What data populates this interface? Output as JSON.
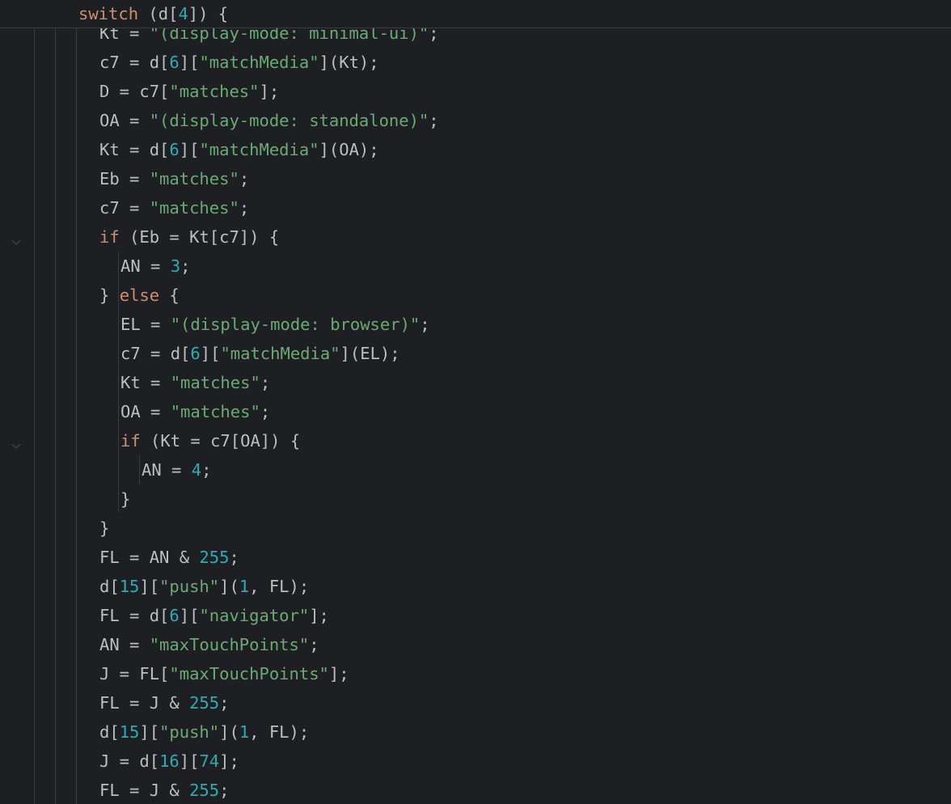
{
  "sticky_header": {
    "tokens": [
      {
        "t": "kw",
        "v": "switch"
      },
      {
        "t": "plain",
        "v": " (d["
      },
      {
        "t": "num",
        "v": "4"
      },
      {
        "t": "plain",
        "v": "]) {"
      }
    ]
  },
  "code_lines": [
    {
      "indent": 2,
      "tokens": [
        {
          "t": "plain",
          "v": "Kt = "
        },
        {
          "t": "str",
          "v": "\"(display-mode: minimal-ui)\""
        },
        {
          "t": "plain",
          "v": ";"
        }
      ]
    },
    {
      "indent": 2,
      "tokens": [
        {
          "t": "plain",
          "v": "c7 = d["
        },
        {
          "t": "num",
          "v": "6"
        },
        {
          "t": "plain",
          "v": "]["
        },
        {
          "t": "str",
          "v": "\"matchMedia\""
        },
        {
          "t": "plain",
          "v": "](Kt);"
        }
      ]
    },
    {
      "indent": 2,
      "tokens": [
        {
          "t": "plain",
          "v": "D = c7["
        },
        {
          "t": "str",
          "v": "\"matches\""
        },
        {
          "t": "plain",
          "v": "];"
        }
      ]
    },
    {
      "indent": 2,
      "tokens": [
        {
          "t": "plain",
          "v": "OA = "
        },
        {
          "t": "str",
          "v": "\"(display-mode: standalone)\""
        },
        {
          "t": "plain",
          "v": ";"
        }
      ]
    },
    {
      "indent": 2,
      "tokens": [
        {
          "t": "plain",
          "v": "Kt = d["
        },
        {
          "t": "num",
          "v": "6"
        },
        {
          "t": "plain",
          "v": "]["
        },
        {
          "t": "str",
          "v": "\"matchMedia\""
        },
        {
          "t": "plain",
          "v": "](OA);"
        }
      ]
    },
    {
      "indent": 2,
      "tokens": [
        {
          "t": "plain",
          "v": "Eb = "
        },
        {
          "t": "str",
          "v": "\"matches\""
        },
        {
          "t": "plain",
          "v": ";"
        }
      ]
    },
    {
      "indent": 2,
      "tokens": [
        {
          "t": "plain",
          "v": "c7 = "
        },
        {
          "t": "str",
          "v": "\"matches\""
        },
        {
          "t": "plain",
          "v": ";"
        }
      ]
    },
    {
      "indent": 2,
      "fold": true,
      "tokens": [
        {
          "t": "kw",
          "v": "if"
        },
        {
          "t": "plain",
          "v": " (Eb = Kt[c7]) {"
        }
      ]
    },
    {
      "indent": 3,
      "tokens": [
        {
          "t": "plain",
          "v": "AN = "
        },
        {
          "t": "num",
          "v": "3"
        },
        {
          "t": "plain",
          "v": ";"
        }
      ]
    },
    {
      "indent": 2,
      "tokens": [
        {
          "t": "plain",
          "v": "} "
        },
        {
          "t": "kw",
          "v": "else"
        },
        {
          "t": "plain",
          "v": " {"
        }
      ]
    },
    {
      "indent": 3,
      "tokens": [
        {
          "t": "plain",
          "v": "EL = "
        },
        {
          "t": "str",
          "v": "\"(display-mode: browser)\""
        },
        {
          "t": "plain",
          "v": ";"
        }
      ]
    },
    {
      "indent": 3,
      "tokens": [
        {
          "t": "plain",
          "v": "c7 = d["
        },
        {
          "t": "num",
          "v": "6"
        },
        {
          "t": "plain",
          "v": "]["
        },
        {
          "t": "str",
          "v": "\"matchMedia\""
        },
        {
          "t": "plain",
          "v": "](EL);"
        }
      ]
    },
    {
      "indent": 3,
      "tokens": [
        {
          "t": "plain",
          "v": "Kt = "
        },
        {
          "t": "str",
          "v": "\"matches\""
        },
        {
          "t": "plain",
          "v": ";"
        }
      ]
    },
    {
      "indent": 3,
      "tokens": [
        {
          "t": "plain",
          "v": "OA = "
        },
        {
          "t": "str",
          "v": "\"matches\""
        },
        {
          "t": "plain",
          "v": ";"
        }
      ]
    },
    {
      "indent": 3,
      "fold": true,
      "tokens": [
        {
          "t": "kw",
          "v": "if"
        },
        {
          "t": "plain",
          "v": " (Kt = c7[OA]) {"
        }
      ]
    },
    {
      "indent": 4,
      "tokens": [
        {
          "t": "plain",
          "v": "AN = "
        },
        {
          "t": "num",
          "v": "4"
        },
        {
          "t": "plain",
          "v": ";"
        }
      ]
    },
    {
      "indent": 3,
      "tokens": [
        {
          "t": "plain",
          "v": "}"
        }
      ]
    },
    {
      "indent": 2,
      "tokens": [
        {
          "t": "plain",
          "v": "}"
        }
      ]
    },
    {
      "indent": 2,
      "tokens": [
        {
          "t": "plain",
          "v": "FL = AN & "
        },
        {
          "t": "num",
          "v": "255"
        },
        {
          "t": "plain",
          "v": ";"
        }
      ]
    },
    {
      "indent": 2,
      "tokens": [
        {
          "t": "plain",
          "v": "d["
        },
        {
          "t": "num",
          "v": "15"
        },
        {
          "t": "plain",
          "v": "]["
        },
        {
          "t": "str",
          "v": "\"push\""
        },
        {
          "t": "plain",
          "v": "]("
        },
        {
          "t": "num",
          "v": "1"
        },
        {
          "t": "plain",
          "v": ", FL);"
        }
      ]
    },
    {
      "indent": 2,
      "tokens": [
        {
          "t": "plain",
          "v": "FL = d["
        },
        {
          "t": "num",
          "v": "6"
        },
        {
          "t": "plain",
          "v": "]["
        },
        {
          "t": "str",
          "v": "\"navigator\""
        },
        {
          "t": "plain",
          "v": "];"
        }
      ]
    },
    {
      "indent": 2,
      "tokens": [
        {
          "t": "plain",
          "v": "AN = "
        },
        {
          "t": "str",
          "v": "\"maxTouchPoints\""
        },
        {
          "t": "plain",
          "v": ";"
        }
      ]
    },
    {
      "indent": 2,
      "tokens": [
        {
          "t": "plain",
          "v": "J = FL["
        },
        {
          "t": "str",
          "v": "\"maxTouchPoints\""
        },
        {
          "t": "plain",
          "v": "];"
        }
      ]
    },
    {
      "indent": 2,
      "tokens": [
        {
          "t": "plain",
          "v": "FL = J & "
        },
        {
          "t": "num",
          "v": "255"
        },
        {
          "t": "plain",
          "v": ";"
        }
      ]
    },
    {
      "indent": 2,
      "tokens": [
        {
          "t": "plain",
          "v": "d["
        },
        {
          "t": "num",
          "v": "15"
        },
        {
          "t": "plain",
          "v": "]["
        },
        {
          "t": "str",
          "v": "\"push\""
        },
        {
          "t": "plain",
          "v": "]("
        },
        {
          "t": "num",
          "v": "1"
        },
        {
          "t": "plain",
          "v": ", FL);"
        }
      ]
    },
    {
      "indent": 2,
      "tokens": [
        {
          "t": "plain",
          "v": "J = d["
        },
        {
          "t": "num",
          "v": "16"
        },
        {
          "t": "plain",
          "v": "]["
        },
        {
          "t": "num",
          "v": "74"
        },
        {
          "t": "plain",
          "v": "];"
        }
      ]
    },
    {
      "indent": 2,
      "tokens": [
        {
          "t": "plain",
          "v": "FL = J & "
        },
        {
          "t": "num",
          "v": "255"
        },
        {
          "t": "plain",
          "v": ";"
        }
      ]
    }
  ]
}
